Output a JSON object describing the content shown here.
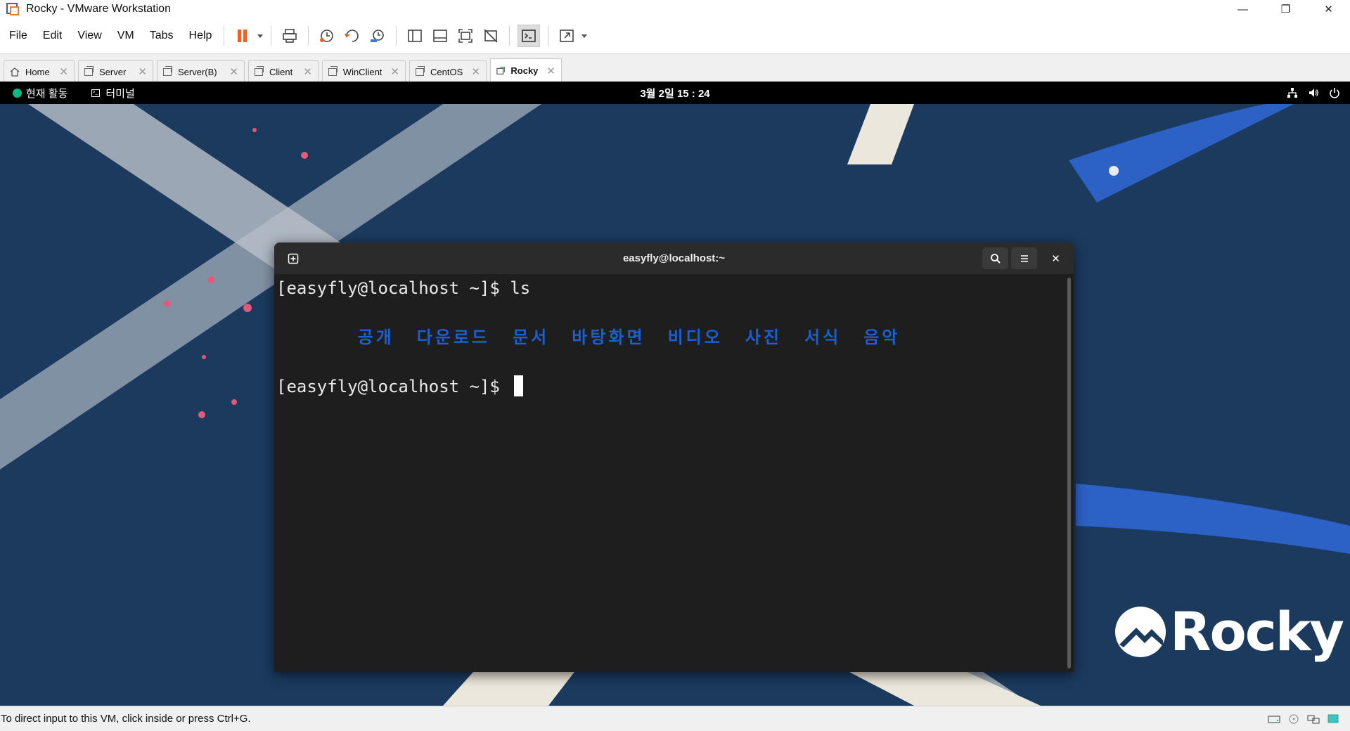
{
  "window": {
    "title": "Rocky - VMware Workstation",
    "minimize": "—",
    "maximize": "❐",
    "close": "✕"
  },
  "menu": [
    "File",
    "Edit",
    "View",
    "VM",
    "Tabs",
    "Help"
  ],
  "tabs": [
    {
      "label": "Home"
    },
    {
      "label": "Server"
    },
    {
      "label": "Server(B)"
    },
    {
      "label": "Client"
    },
    {
      "label": "WinClient"
    },
    {
      "label": "CentOS"
    },
    {
      "label": "Rocky",
      "active": true
    }
  ],
  "gnome": {
    "activities": "현재 활동",
    "app": "터미널",
    "clock": "3월 2일  15 : 24"
  },
  "terminal": {
    "title": "easyfly@localhost:~",
    "line1": "[easyfly@localhost ~]$ ls",
    "ls_items": [
      "공개",
      "다운로드",
      "문서",
      "바탕화면",
      "비디오",
      "사진",
      "서식",
      "음악"
    ],
    "prompt": "[easyfly@localhost ~]$ ",
    "dir_color": "#1a5fd3"
  },
  "desktop": {
    "logo_text": "Rocky",
    "accent": "#10b981"
  },
  "statusbar": {
    "message": "To direct input to this VM, click inside or press Ctrl+G."
  },
  "icons": [
    "pause-icon",
    "snapshot-icon",
    "revert-icon",
    "manage-snapshots-icon",
    "console-view-icon",
    "fullscreen-icon",
    "search-icon",
    "hamburger-menu-icon",
    "new-tab-icon"
  ]
}
